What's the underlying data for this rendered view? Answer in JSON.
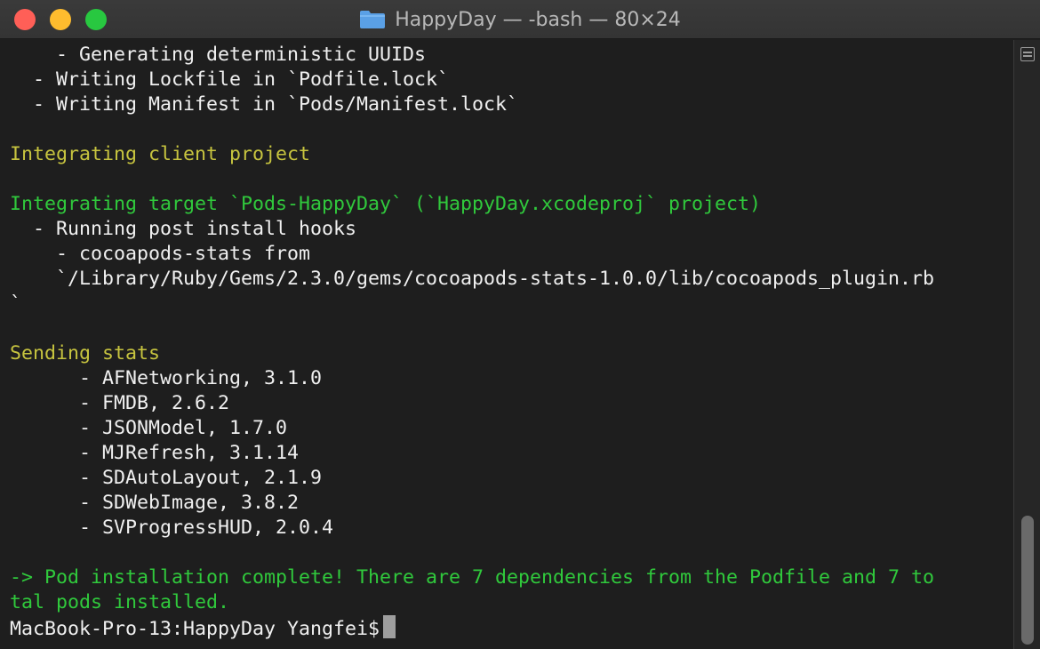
{
  "window": {
    "title": "HappyDay — -bash — 80×24",
    "traffic_lights": {
      "close": "#ff5f57",
      "minimize": "#febc2e",
      "zoom": "#28c840"
    },
    "folder_icon": "folder-icon",
    "folder_color": "#5aa0e6"
  },
  "terminal": {
    "colors": {
      "background": "#1e1e1e",
      "default": "#f0f0f0",
      "yellow": "#c7c43f",
      "green": "#30c93c",
      "cursor": "#9e9e9e"
    },
    "lines": [
      {
        "text": "    - Generating deterministic UUIDs",
        "color": "default"
      },
      {
        "text": "  - Writing Lockfile in `Podfile.lock`",
        "color": "default"
      },
      {
        "text": "  - Writing Manifest in `Pods/Manifest.lock`",
        "color": "default"
      },
      {
        "text": "",
        "color": "default"
      },
      {
        "text": "Integrating client project",
        "color": "yellow"
      },
      {
        "text": "",
        "color": "default"
      },
      {
        "text": "Integrating target `Pods-HappyDay` (`HappyDay.xcodeproj` project)",
        "color": "green"
      },
      {
        "text": "  - Running post install hooks",
        "color": "default"
      },
      {
        "text": "    - cocoapods-stats from",
        "color": "default"
      },
      {
        "text": "    `/Library/Ruby/Gems/2.3.0/gems/cocoapods-stats-1.0.0/lib/cocoapods_plugin.rb",
        "color": "default"
      },
      {
        "text": "`",
        "color": "default"
      },
      {
        "text": "",
        "color": "default"
      },
      {
        "text": "Sending stats",
        "color": "yellow"
      },
      {
        "text": "      - AFNetworking, 3.1.0",
        "color": "default"
      },
      {
        "text": "      - FMDB, 2.6.2",
        "color": "default"
      },
      {
        "text": "      - JSONModel, 1.7.0",
        "color": "default"
      },
      {
        "text": "      - MJRefresh, 3.1.14",
        "color": "default"
      },
      {
        "text": "      - SDAutoLayout, 2.1.9",
        "color": "default"
      },
      {
        "text": "      - SDWebImage, 3.8.2",
        "color": "default"
      },
      {
        "text": "      - SVProgressHUD, 2.0.4",
        "color": "default"
      },
      {
        "text": "",
        "color": "default"
      },
      {
        "text": "-> Pod installation complete! There are 7 dependencies from the Podfile and 7 to",
        "color": "green"
      },
      {
        "text": "tal pods installed.",
        "color": "green"
      }
    ],
    "prompt": "MacBook-Pro-13:HappyDay Yangfei$"
  }
}
